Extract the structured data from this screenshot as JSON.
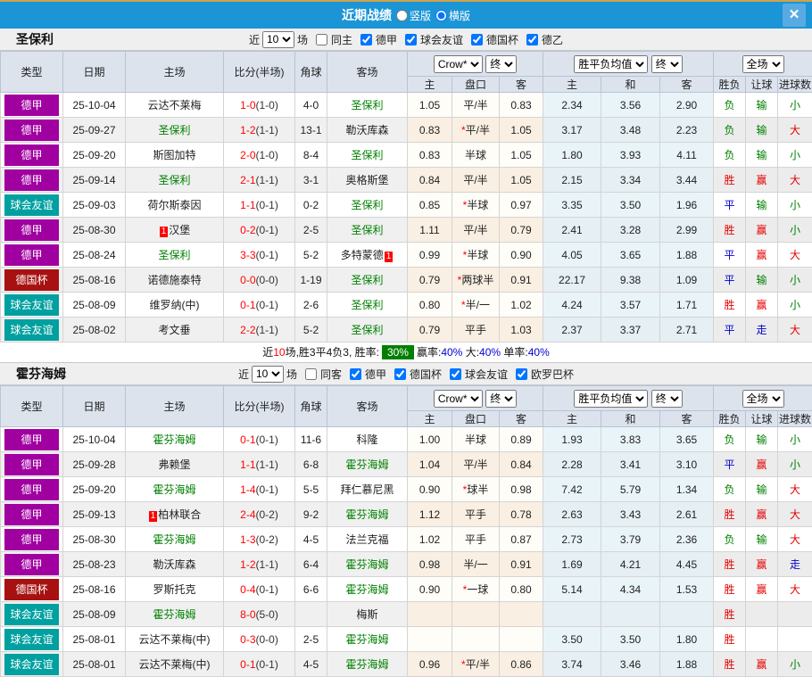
{
  "colors": {
    "titlebar": "#1b95d6",
    "league": {
      "德甲": "#a100a1",
      "球会友谊": "#00a0a0",
      "德国杯": "#a81111",
      "德乙": "#a100a1",
      "欧罗巴杯": "#00a0a0"
    },
    "team_green": "#008000",
    "score_red": "#ff0000",
    "result": {
      "r": "#e60000",
      "g": "#008000",
      "b": "#0000cc"
    }
  },
  "titlebar": {
    "title": "近期战绩",
    "layout_options": [
      {
        "label": "竖版",
        "selected": false
      },
      {
        "label": "横版",
        "selected": true
      }
    ],
    "close_label": "✕"
  },
  "header": {
    "cols": [
      "类型",
      "日期",
      "主场",
      "比分(半场)",
      "角球",
      "客场"
    ],
    "sub": [
      "主",
      "盘口",
      "客",
      "主",
      "和",
      "客",
      "胜负",
      "让球",
      "进球数"
    ],
    "selects": {
      "odds_source": "Crow*",
      "odds_final": "终",
      "avg": "胜平负均值",
      "avg_final": "终",
      "scope": "全场"
    }
  },
  "sections": [
    {
      "team": "圣保利",
      "filter": {
        "near": "近",
        "count": "10",
        "games": "场",
        "same": {
          "label": "同主",
          "checked": false
        },
        "leagues": [
          {
            "label": "德甲",
            "checked": true
          },
          {
            "label": "球会友谊",
            "checked": true
          },
          {
            "label": "德国杯",
            "checked": true
          },
          {
            "label": "德乙",
            "checked": true
          }
        ]
      },
      "rows": [
        {
          "lg": "德甲",
          "date": "25-10-04",
          "home": "云达不莱梅",
          "hg": false,
          "hb": "",
          "ft": "1-0",
          "ht": "(1-0)",
          "cor": "4-0",
          "away": "圣保利",
          "ag": true,
          "ab": "",
          "o1": "1.05",
          "hd": "平/半",
          "st": false,
          "o2": "0.83",
          "a1": "2.34",
          "a2": "3.56",
          "a3": "2.90",
          "r1": [
            "负",
            "g"
          ],
          "r2": [
            "输",
            "g"
          ],
          "r3": [
            "小",
            "g"
          ]
        },
        {
          "lg": "德甲",
          "date": "25-09-27",
          "home": "圣保利",
          "hg": true,
          "hb": "",
          "ft": "1-2",
          "ht": "(1-1)",
          "cor": "13-1",
          "away": "勒沃库森",
          "ag": false,
          "ab": "",
          "o1": "0.83",
          "hd": "平/半",
          "st": true,
          "o2": "1.05",
          "a1": "3.17",
          "a2": "3.48",
          "a3": "2.23",
          "r1": [
            "负",
            "g"
          ],
          "r2": [
            "输",
            "g"
          ],
          "r3": [
            "大",
            "r"
          ]
        },
        {
          "lg": "德甲",
          "date": "25-09-20",
          "home": "斯图加特",
          "hg": false,
          "hb": "",
          "ft": "2-0",
          "ht": "(1-0)",
          "cor": "8-4",
          "away": "圣保利",
          "ag": true,
          "ab": "",
          "o1": "0.83",
          "hd": "半球",
          "st": false,
          "o2": "1.05",
          "a1": "1.80",
          "a2": "3.93",
          "a3": "4.11",
          "r1": [
            "负",
            "g"
          ],
          "r2": [
            "输",
            "g"
          ],
          "r3": [
            "小",
            "g"
          ]
        },
        {
          "lg": "德甲",
          "date": "25-09-14",
          "home": "圣保利",
          "hg": true,
          "hb": "",
          "ft": "2-1",
          "ht": "(1-1)",
          "cor": "3-1",
          "away": "奥格斯堡",
          "ag": false,
          "ab": "",
          "o1": "0.84",
          "hd": "平/半",
          "st": false,
          "o2": "1.05",
          "a1": "2.15",
          "a2": "3.34",
          "a3": "3.44",
          "r1": [
            "胜",
            "r"
          ],
          "r2": [
            "赢",
            "r"
          ],
          "r3": [
            "大",
            "r"
          ]
        },
        {
          "lg": "球会友谊",
          "date": "25-09-03",
          "home": "荷尔斯泰因",
          "hg": false,
          "hb": "",
          "ft": "1-1",
          "ht": "(0-1)",
          "cor": "0-2",
          "away": "圣保利",
          "ag": true,
          "ab": "",
          "o1": "0.85",
          "hd": "半球",
          "st": true,
          "o2": "0.97",
          "a1": "3.35",
          "a2": "3.50",
          "a3": "1.96",
          "r1": [
            "平",
            "b"
          ],
          "r2": [
            "输",
            "g"
          ],
          "r3": [
            "小",
            "g"
          ]
        },
        {
          "lg": "德甲",
          "date": "25-08-30",
          "home": "汉堡",
          "hg": false,
          "hb": "1",
          "ft": "0-2",
          "ht": "(0-1)",
          "cor": "2-5",
          "away": "圣保利",
          "ag": true,
          "ab": "",
          "o1": "1.11",
          "hd": "平/半",
          "st": false,
          "o2": "0.79",
          "a1": "2.41",
          "a2": "3.28",
          "a3": "2.99",
          "r1": [
            "胜",
            "r"
          ],
          "r2": [
            "赢",
            "r"
          ],
          "r3": [
            "小",
            "g"
          ]
        },
        {
          "lg": "德甲",
          "date": "25-08-24",
          "home": "圣保利",
          "hg": true,
          "hb": "",
          "ft": "3-3",
          "ht": "(0-1)",
          "cor": "5-2",
          "away": "多特蒙德",
          "ag": false,
          "ab": "1",
          "o1": "0.99",
          "hd": "半球",
          "st": true,
          "o2": "0.90",
          "a1": "4.05",
          "a2": "3.65",
          "a3": "1.88",
          "r1": [
            "平",
            "b"
          ],
          "r2": [
            "赢",
            "r"
          ],
          "r3": [
            "大",
            "r"
          ]
        },
        {
          "lg": "德国杯",
          "date": "25-08-16",
          "home": "诺德施泰特",
          "hg": false,
          "hb": "",
          "ft": "0-0",
          "ht": "(0-0)",
          "cor": "1-19",
          "away": "圣保利",
          "ag": true,
          "ab": "",
          "o1": "0.79",
          "hd": "两球半",
          "st": true,
          "o2": "0.91",
          "a1": "22.17",
          "a2": "9.38",
          "a3": "1.09",
          "r1": [
            "平",
            "b"
          ],
          "r2": [
            "输",
            "g"
          ],
          "r3": [
            "小",
            "g"
          ]
        },
        {
          "lg": "球会友谊",
          "date": "25-08-09",
          "home": "维罗纳(中)",
          "hg": false,
          "hb": "",
          "ft": "0-1",
          "ht": "(0-1)",
          "cor": "2-6",
          "away": "圣保利",
          "ag": true,
          "ab": "",
          "o1": "0.80",
          "hd": "半/一",
          "st": true,
          "o2": "1.02",
          "a1": "4.24",
          "a2": "3.57",
          "a3": "1.71",
          "r1": [
            "胜",
            "r"
          ],
          "r2": [
            "赢",
            "r"
          ],
          "r3": [
            "小",
            "g"
          ]
        },
        {
          "lg": "球会友谊",
          "date": "25-08-02",
          "home": "考文垂",
          "hg": false,
          "hb": "",
          "ft": "2-2",
          "ht": "(1-1)",
          "cor": "5-2",
          "away": "圣保利",
          "ag": true,
          "ab": "",
          "o1": "0.79",
          "hd": "平手",
          "st": false,
          "o2": "1.03",
          "a1": "2.37",
          "a2": "3.37",
          "a3": "2.71",
          "r1": [
            "平",
            "b"
          ],
          "r2": [
            "走",
            "b"
          ],
          "r3": [
            "大",
            "r"
          ]
        }
      ],
      "summary": {
        "parts": [
          {
            "t": "近",
            "s": "k"
          },
          {
            "t": "10",
            "s": "r"
          },
          {
            "t": "场,胜3平4负3, 胜率:",
            "s": "k"
          },
          {
            "t": "30%",
            "s": "box"
          },
          {
            "t": "赢率:",
            "s": "k"
          },
          {
            "t": "40%",
            "s": "b"
          },
          {
            "t": " 大:",
            "s": "k"
          },
          {
            "t": "40%",
            "s": "b"
          },
          {
            "t": " 单率:",
            "s": "k"
          },
          {
            "t": "40%",
            "s": "b"
          }
        ]
      }
    },
    {
      "team": "霍芬海姆",
      "filter": {
        "near": "近",
        "count": "10",
        "games": "场",
        "same": {
          "label": "同客",
          "checked": false
        },
        "leagues": [
          {
            "label": "德甲",
            "checked": true
          },
          {
            "label": "德国杯",
            "checked": true
          },
          {
            "label": "球会友谊",
            "checked": true
          },
          {
            "label": "欧罗巴杯",
            "checked": true
          }
        ]
      },
      "rows": [
        {
          "lg": "德甲",
          "date": "25-10-04",
          "home": "霍芬海姆",
          "hg": true,
          "hb": "",
          "ft": "0-1",
          "ht": "(0-1)",
          "cor": "11-6",
          "away": "科隆",
          "ag": false,
          "ab": "",
          "o1": "1.00",
          "hd": "半球",
          "st": false,
          "o2": "0.89",
          "a1": "1.93",
          "a2": "3.83",
          "a3": "3.65",
          "r1": [
            "负",
            "g"
          ],
          "r2": [
            "输",
            "g"
          ],
          "r3": [
            "小",
            "g"
          ]
        },
        {
          "lg": "德甲",
          "date": "25-09-28",
          "home": "弗赖堡",
          "hg": false,
          "hb": "",
          "ft": "1-1",
          "ht": "(1-1)",
          "cor": "6-8",
          "away": "霍芬海姆",
          "ag": true,
          "ab": "",
          "o1": "1.04",
          "hd": "平/半",
          "st": false,
          "o2": "0.84",
          "a1": "2.28",
          "a2": "3.41",
          "a3": "3.10",
          "r1": [
            "平",
            "b"
          ],
          "r2": [
            "赢",
            "r"
          ],
          "r3": [
            "小",
            "g"
          ]
        },
        {
          "lg": "德甲",
          "date": "25-09-20",
          "home": "霍芬海姆",
          "hg": true,
          "hb": "",
          "ft": "1-4",
          "ht": "(0-1)",
          "cor": "5-5",
          "away": "拜仁慕尼黑",
          "ag": false,
          "ab": "",
          "o1": "0.90",
          "hd": "球半",
          "st": true,
          "o2": "0.98",
          "a1": "7.42",
          "a2": "5.79",
          "a3": "1.34",
          "r1": [
            "负",
            "g"
          ],
          "r2": [
            "输",
            "g"
          ],
          "r3": [
            "大",
            "r"
          ]
        },
        {
          "lg": "德甲",
          "date": "25-09-13",
          "home": "柏林联合",
          "hg": false,
          "hb": "1",
          "ft": "2-4",
          "ht": "(0-2)",
          "cor": "9-2",
          "away": "霍芬海姆",
          "ag": true,
          "ab": "",
          "o1": "1.12",
          "hd": "平手",
          "st": false,
          "o2": "0.78",
          "a1": "2.63",
          "a2": "3.43",
          "a3": "2.61",
          "r1": [
            "胜",
            "r"
          ],
          "r2": [
            "赢",
            "r"
          ],
          "r3": [
            "大",
            "r"
          ]
        },
        {
          "lg": "德甲",
          "date": "25-08-30",
          "home": "霍芬海姆",
          "hg": true,
          "hb": "",
          "ft": "1-3",
          "ht": "(0-2)",
          "cor": "4-5",
          "away": "法兰克福",
          "ag": false,
          "ab": "",
          "o1": "1.02",
          "hd": "平手",
          "st": false,
          "o2": "0.87",
          "a1": "2.73",
          "a2": "3.79",
          "a3": "2.36",
          "r1": [
            "负",
            "g"
          ],
          "r2": [
            "输",
            "g"
          ],
          "r3": [
            "大",
            "r"
          ]
        },
        {
          "lg": "德甲",
          "date": "25-08-23",
          "home": "勒沃库森",
          "hg": false,
          "hb": "",
          "ft": "1-2",
          "ht": "(1-1)",
          "cor": "6-4",
          "away": "霍芬海姆",
          "ag": true,
          "ab": "",
          "o1": "0.98",
          "hd": "半/一",
          "st": false,
          "o2": "0.91",
          "a1": "1.69",
          "a2": "4.21",
          "a3": "4.45",
          "r1": [
            "胜",
            "r"
          ],
          "r2": [
            "赢",
            "r"
          ],
          "r3": [
            "走",
            "b"
          ]
        },
        {
          "lg": "德国杯",
          "date": "25-08-16",
          "home": "罗斯托克",
          "hg": false,
          "hb": "",
          "ft": "0-4",
          "ht": "(0-1)",
          "cor": "6-6",
          "away": "霍芬海姆",
          "ag": true,
          "ab": "",
          "o1": "0.90",
          "hd": "一球",
          "st": true,
          "o2": "0.80",
          "a1": "5.14",
          "a2": "4.34",
          "a3": "1.53",
          "r1": [
            "胜",
            "r"
          ],
          "r2": [
            "赢",
            "r"
          ],
          "r3": [
            "大",
            "r"
          ]
        },
        {
          "lg": "球会友谊",
          "date": "25-08-09",
          "home": "霍芬海姆",
          "hg": true,
          "hb": "",
          "ft": "8-0",
          "ht": "(5-0)",
          "cor": "",
          "away": "梅斯",
          "ag": false,
          "ab": "",
          "o1": "",
          "hd": "",
          "st": false,
          "o2": "",
          "a1": "",
          "a2": "",
          "a3": "",
          "r1": [
            "胜",
            "r"
          ],
          "r2": [
            "",
            ""
          ],
          "r3": [
            "",
            ""
          ]
        },
        {
          "lg": "球会友谊",
          "date": "25-08-01",
          "home": "云达不莱梅(中)",
          "hg": false,
          "hb": "",
          "ft": "0-3",
          "ht": "(0-0)",
          "cor": "2-5",
          "away": "霍芬海姆",
          "ag": true,
          "ab": "",
          "o1": "",
          "hd": "",
          "st": false,
          "o2": "",
          "a1": "3.50",
          "a2": "3.50",
          "a3": "1.80",
          "r1": [
            "胜",
            "r"
          ],
          "r2": [
            "",
            ""
          ],
          "r3": [
            "",
            ""
          ]
        },
        {
          "lg": "球会友谊",
          "date": "25-08-01",
          "home": "云达不莱梅(中)",
          "hg": false,
          "hb": "",
          "ft": "0-1",
          "ht": "(0-1)",
          "cor": "4-5",
          "away": "霍芬海姆",
          "ag": true,
          "ab": "",
          "o1": "0.96",
          "hd": "平/半",
          "st": true,
          "o2": "0.86",
          "a1": "3.74",
          "a2": "3.46",
          "a3": "1.88",
          "r1": [
            "胜",
            "r"
          ],
          "r2": [
            "赢",
            "r"
          ],
          "r3": [
            "小",
            "g"
          ]
        }
      ],
      "summary": null
    }
  ]
}
